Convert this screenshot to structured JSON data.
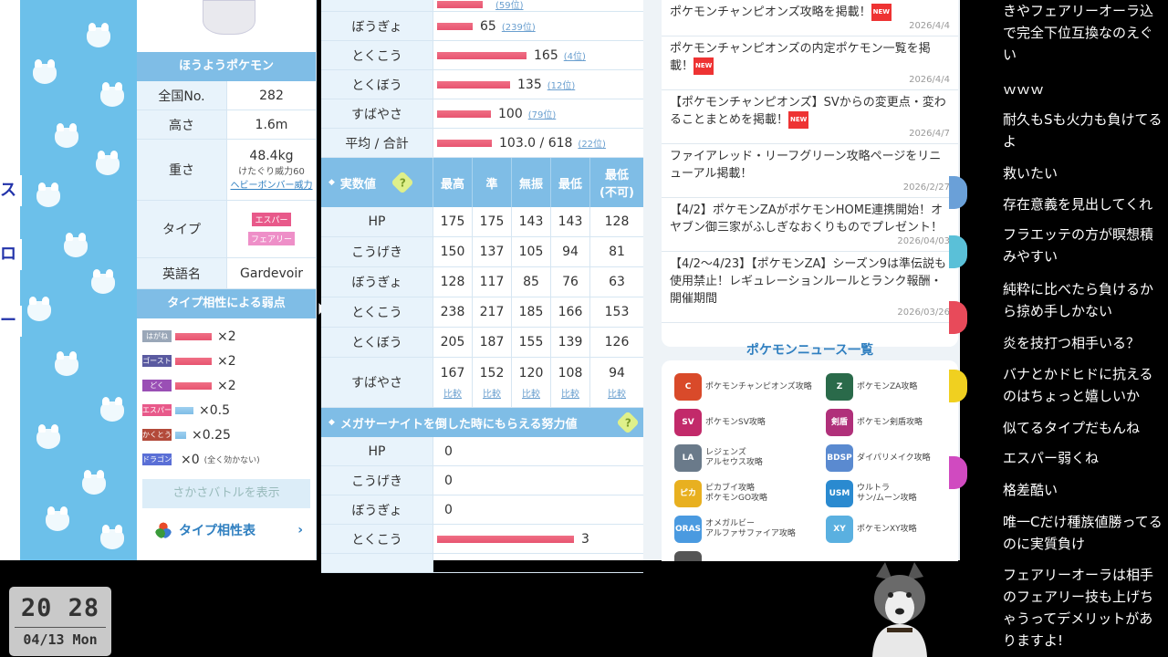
{
  "left_strip": {
    "frag1": "ス",
    "frag2": "ロ",
    "frag3": "ー"
  },
  "profile": {
    "header": "ほうようポケモン",
    "rows": [
      {
        "k": "全国No.",
        "v": "282"
      },
      {
        "k": "高さ",
        "v": "1.6m"
      },
      {
        "k": "重さ",
        "v": "48.4kg",
        "sub1": "けたぐり威力60",
        "sub2": "ヘビーボンバー威力"
      },
      {
        "k": "タイプ",
        "types": [
          "エスパー",
          "フェアリー"
        ]
      },
      {
        "k": "英語名",
        "v": "Gardevoir"
      }
    ]
  },
  "weakness": {
    "header": "タイプ相性による弱点",
    "items": [
      {
        "type": "はがね",
        "mult": "×2",
        "color": "#9aa7b8"
      },
      {
        "type": "ゴースト",
        "mult": "×2",
        "color": "#5a5aa0"
      },
      {
        "type": "どく",
        "mult": "×2",
        "color": "#9a4fb5"
      },
      {
        "type": "エスパー",
        "mult": "×0.5",
        "color": "#e8598a"
      },
      {
        "type": "かくとう",
        "mult": "×0.25",
        "color": "#b34a3a"
      },
      {
        "type": "ドラゴン",
        "mult": "×0",
        "note": "(全く効かない)",
        "color": "#5a6fd6"
      }
    ],
    "reverse_button": "さかさバトルを表示",
    "chart_link": "タイプ相性表"
  },
  "base_stats": {
    "rows": [
      {
        "k": "ぼうぎょ",
        "v": "65",
        "rank": "(239位)",
        "pct": 0.28
      },
      {
        "k": "とくこう",
        "v": "165",
        "rank": "(4位)",
        "pct": 0.7
      },
      {
        "k": "とくぼう",
        "v": "135",
        "rank": "(12位)",
        "pct": 0.57
      },
      {
        "k": "すばやさ",
        "v": "100",
        "rank": "(79位)",
        "pct": 0.42
      },
      {
        "k": "平均 / 合計",
        "v": "103.0 / 618",
        "rank": "(22位)",
        "pct": 0.43
      }
    ],
    "top_fragment_rank": "(59位)"
  },
  "real_values": {
    "header": "実数値",
    "help": "?",
    "cols": [
      "最高",
      "準",
      "無振",
      "最低",
      "最低\n(不可)"
    ],
    "col_a": "最低",
    "col_b": "(不可)",
    "rows": [
      {
        "k": "HP",
        "vals": [
          "175",
          "175",
          "143",
          "143",
          "128"
        ]
      },
      {
        "k": "こうげき",
        "vals": [
          "150",
          "137",
          "105",
          "94",
          "81"
        ]
      },
      {
        "k": "ぼうぎょ",
        "vals": [
          "128",
          "117",
          "85",
          "76",
          "63"
        ]
      },
      {
        "k": "とくこう",
        "vals": [
          "238",
          "217",
          "185",
          "166",
          "153"
        ]
      },
      {
        "k": "とくぼう",
        "vals": [
          "205",
          "187",
          "155",
          "139",
          "126"
        ]
      },
      {
        "k": "すばやさ",
        "vals": [
          "167",
          "152",
          "120",
          "108",
          "94"
        ]
      }
    ],
    "compare": "比較"
  },
  "ev_yield": {
    "header": "メガサーナイトを倒した時にもらえる努力値",
    "rows": [
      {
        "k": "HP",
        "v": "0",
        "pct": 0
      },
      {
        "k": "こうげき",
        "v": "0",
        "pct": 0
      },
      {
        "k": "ぼうぎょ",
        "v": "0",
        "pct": 0
      },
      {
        "k": "とくこう",
        "v": "3",
        "pct": 0.68
      }
    ]
  },
  "news": {
    "items": [
      {
        "title": "ポケモンチャンピオンズ攻略を掲載！",
        "date": "2026/4/4",
        "new": "NEW"
      },
      {
        "title": "ポケモンチャンピオンズの内定ポケモン一覧を掲載！",
        "date": "2026/4/4",
        "new": "NEW"
      },
      {
        "title": "【ポケモンチャンピオンズ】SVからの変更点・変わることまとめを掲載！",
        "date": "2026/4/7",
        "new": "NEW"
      },
      {
        "title": "ファイアレッド・リーフグリーン攻略ページをリニューアル掲載！",
        "date": "2026/2/27",
        "new": ""
      },
      {
        "title": "【4/2】ポケモンZAがポケモンHOME連携開始！オヤブン御三家がふしぎなおくりものでプレゼント！",
        "date": "2026/04/03",
        "new": ""
      },
      {
        "title": "【4/2〜4/23】【ポケモンZA】シーズン9は準伝説も使用禁止！レギュレーションルールとランク報酬・開催期間",
        "date": "2026/03/26",
        "new": ""
      }
    ],
    "more": "ポケモンニュース一覧"
  },
  "games": [
    {
      "label": "ポケモンチャンピオンズ攻略",
      "icon": "C",
      "color": "#d94a2a"
    },
    {
      "label": "ポケモンZA攻略",
      "icon": "Z",
      "color": "#2a6a4a"
    },
    {
      "label": "ポケモンSV攻略",
      "icon": "SV",
      "color": "#c22a6a"
    },
    {
      "label": "ポケモン剣盾攻略",
      "icon": "剣盾",
      "color": "#b0307a"
    },
    {
      "label": "レジェンズ\nアルセウス攻略",
      "icon": "LA",
      "color": "#6a7a8a"
    },
    {
      "label": "ダイパリメイク攻略",
      "icon": "BDSP",
      "color": "#5a8ad0"
    },
    {
      "label": "ピカブイ攻略\nポケモンGO攻略",
      "icon": "ピカ",
      "color": "#e8b020"
    },
    {
      "label": "ウルトラ\nサン/ムーン攻略",
      "icon": "USM",
      "color": "#2a8ad0"
    },
    {
      "label": "オメガルビー\nアルファサファイア攻略",
      "icon": "ORAS",
      "color": "#4a9ae0"
    },
    {
      "label": "ポケモンXY攻略",
      "icon": "XY",
      "color": "#5ab0e0"
    }
  ],
  "chat": [
    "きやフェアリーオーラ込で完全下位互換なのえぐい",
    "ｗｗｗ",
    "耐久もSも火力も負けてるよ",
    "救いたい",
    "存在意義を見出してくれ",
    "フラエッテの方が瞑想積みやすい",
    "純粋に比べたら負けるから掠め手しかない",
    "炎を技打つ相手いる？",
    "バナとかドヒドに抗えるのはちょっと嬉しいか",
    "似てるタイプだもんね",
    "エスパー弱くね",
    "格差酷い",
    "唯一Cだけ種族値勝ってるのに実質負け",
    "フェアリーオーラは相手のフェアリー技も上げちゃうってデメリットがありますよ!"
  ],
  "clock": {
    "time_h": "20",
    "time_m": "28",
    "date": "04/13 Mon"
  },
  "colors": {
    "accent": "#7fbde6",
    "bar": "#e85470",
    "link": "#2f7fc0"
  }
}
